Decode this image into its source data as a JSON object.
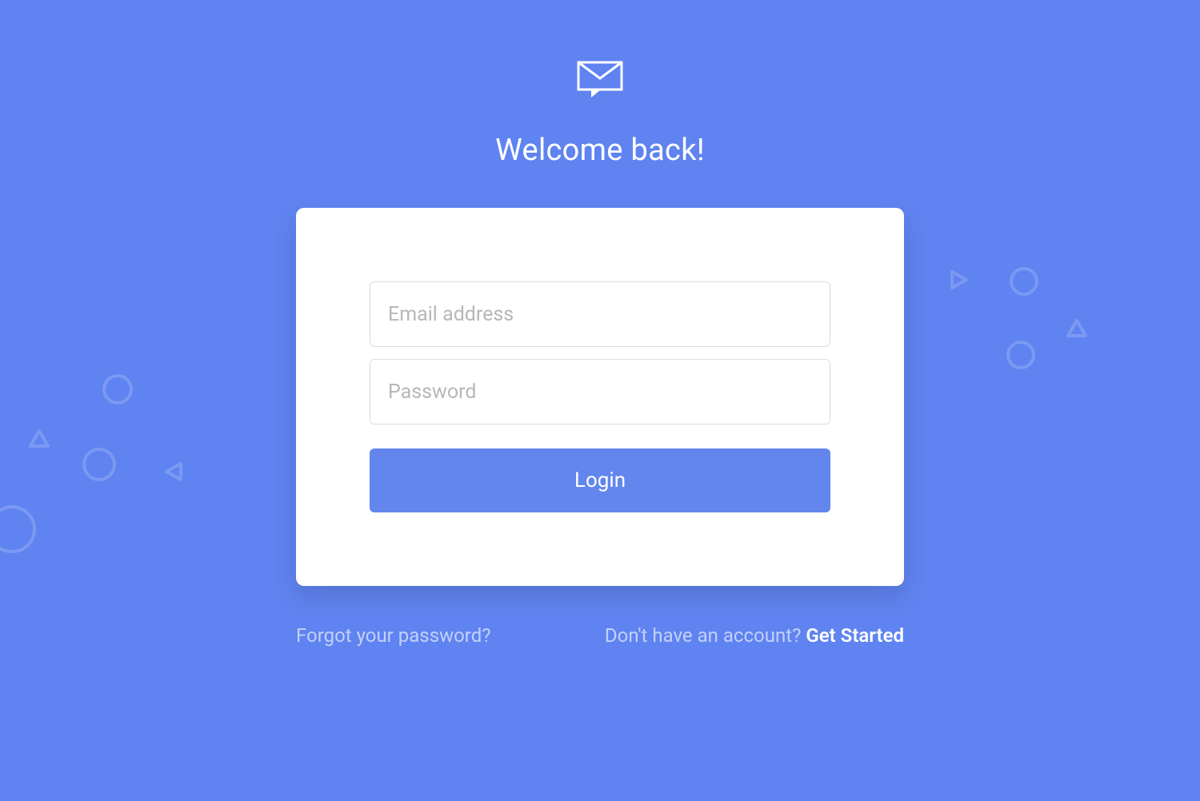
{
  "header": {
    "title": "Welcome back!"
  },
  "form": {
    "email_placeholder": "Email address",
    "password_placeholder": "Password",
    "login_label": "Login"
  },
  "footer": {
    "forgot_label": "Forgot your password?",
    "signup_prefix": "Don't have an account? ",
    "signup_link": "Get Started"
  }
}
